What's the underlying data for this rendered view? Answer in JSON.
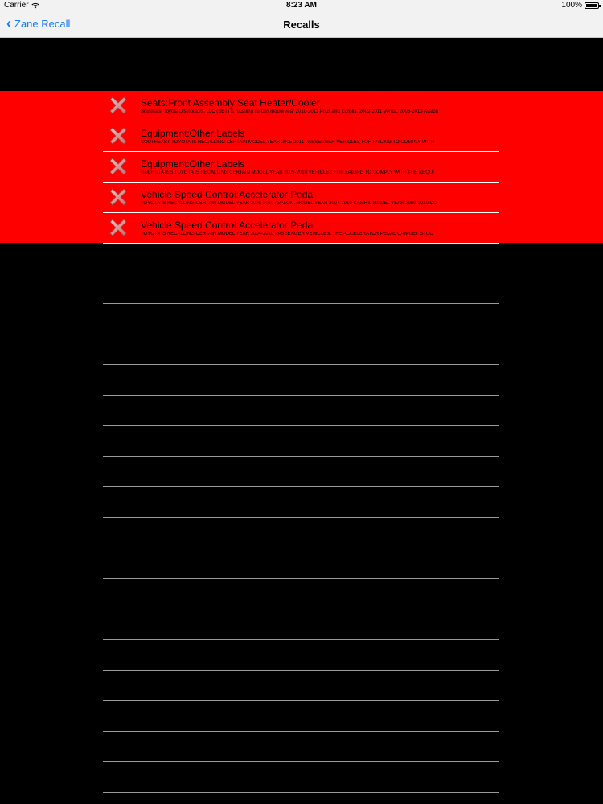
{
  "status_bar": {
    "carrier": "Carrier",
    "time": "8:23 AM",
    "battery": "100%",
    "battery_level": 1.0
  },
  "nav": {
    "back_label": "Zane Recall",
    "title": "Recalls"
  },
  "accent_color": "#1a7cf5",
  "highlight_color": "#ff0000",
  "recalls": [
    {
      "title": "Seats:Front Assembly:Seat Heater/Cooler",
      "description": "Southeast Toyota Distributors, LLC (SET) is recalling certain model year 2010-2011 Prius and Corolla, 2009-2011 Venza, 2006-2010 Avalon",
      "icon": "close-x-icon"
    },
    {
      "title": "Equipment:Other:Labels",
      "description": "SOUTHEAST TOYOTA IS RECALLING CERTAIN MODEL YEAR 2005-2011 PASSENGER VEHICLES FOR FAILING TO COMPLY WITH",
      "icon": "close-x-icon"
    },
    {
      "title": "Equipment:Other:Labels",
      "description": "GULF STATES TOYOTA IS RECALLING CERTAIN MODEL YEAR 2005-2010 VEHICLES FOR FAILING TO COMPLY WITH THE REQUI",
      "icon": "close-x-icon"
    },
    {
      "title": "Vehicle Speed Control:Accelerator Pedal",
      "description": "TOYOTA IS RECALLING CERTAIN MODEL YEAR 2005-2010 AVALON, MODEL YEAR 2007-2010 CAMRY, MODEL YEAR 2009-2010 CO",
      "icon": "close-x-icon"
    },
    {
      "title": "Vehicle Speed Control:Accelerator Pedal",
      "description": "TOYOTA IS RECALLING CERTAIN MODEL YEAR 2004-2010 PASSENGER VEHICLES.  THE ACCELERATOR PEDAL CAN GET STUC",
      "icon": "close-x-icon"
    }
  ]
}
